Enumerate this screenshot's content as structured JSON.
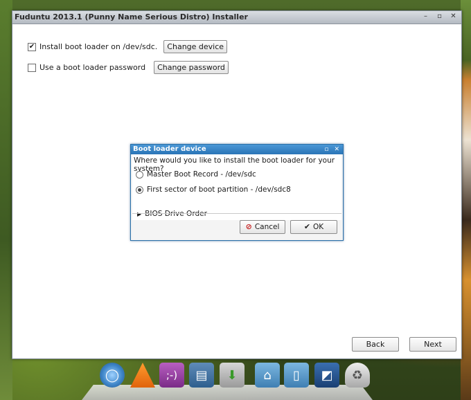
{
  "window": {
    "title": "Fuduntu 2013.1 (Punny Name Serious Distro) Installer"
  },
  "options": {
    "install_bootloader_label": "Install boot loader on /dev/sdc.",
    "install_bootloader_checked": true,
    "change_device_label": "Change device",
    "use_password_label": "Use a boot loader password",
    "use_password_checked": false,
    "change_password_label": "Change password"
  },
  "dialog": {
    "title": "Boot loader device",
    "question": "Where would you like to install the boot loader for your system?",
    "radios": [
      {
        "label": "Master Boot Record - /dev/sdc",
        "selected": false
      },
      {
        "label": "First sector of boot partition - /dev/sdc8",
        "selected": true
      }
    ],
    "expander_label": "BIOS Drive Order",
    "cancel_label": "Cancel",
    "ok_label": "OK"
  },
  "navigation": {
    "back_label": "Back",
    "next_label": "Next"
  },
  "dock": {
    "icons": [
      "chromium-icon",
      "vlc-icon",
      "pidgin-icon",
      "document-viewer-icon",
      "installer-icon",
      "home-folder-icon",
      "documents-folder-icon",
      "desktop-settings-icon",
      "trash-icon"
    ]
  }
}
